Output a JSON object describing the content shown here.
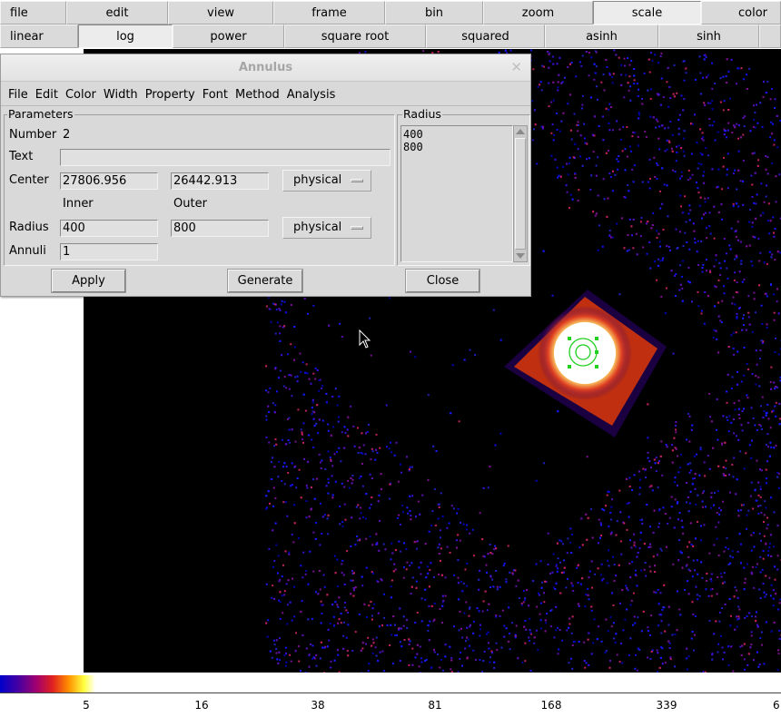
{
  "toolbar_main": [
    {
      "label": "file",
      "active": false
    },
    {
      "label": "edit",
      "active": false
    },
    {
      "label": "view",
      "active": false
    },
    {
      "label": "frame",
      "active": false
    },
    {
      "label": "bin",
      "active": false
    },
    {
      "label": "zoom",
      "active": false
    },
    {
      "label": "scale",
      "active": true
    },
    {
      "label": "color",
      "active": false
    }
  ],
  "toolbar_scale": [
    {
      "label": "linear",
      "active": false
    },
    {
      "label": "log",
      "active": true
    },
    {
      "label": "power",
      "active": false
    },
    {
      "label": "square root",
      "active": false
    },
    {
      "label": "squared",
      "active": false
    },
    {
      "label": "asinh",
      "active": false
    },
    {
      "label": "sinh",
      "active": false
    },
    {
      "label": "",
      "active": false
    }
  ],
  "dialog": {
    "title": "Annulus",
    "menus": [
      "File",
      "Edit",
      "Color",
      "Width",
      "Property",
      "Font",
      "Method",
      "Analysis"
    ],
    "parameters_legend": "Parameters",
    "number_label": "Number",
    "number_value": "2",
    "text_label": "Text",
    "text_value": "",
    "center_label": "Center",
    "center_x": "27806.956",
    "center_y": "26442.913",
    "center_coord": "physical",
    "inner_label": "Inner",
    "outer_label": "Outer",
    "radius_label": "Radius",
    "radius_inner": "400",
    "radius_outer": "800",
    "radius_coord": "physical",
    "annuli_label": "Annuli",
    "annuli_value": "1",
    "radius_legend": "Radius",
    "radius_list": [
      "400",
      "800"
    ],
    "apply_label": "Apply",
    "generate_label": "Generate",
    "close_label": "Close"
  },
  "colorbar": {
    "ticks": [
      "5",
      "16",
      "38",
      "81",
      "168",
      "339",
      "6"
    ]
  }
}
